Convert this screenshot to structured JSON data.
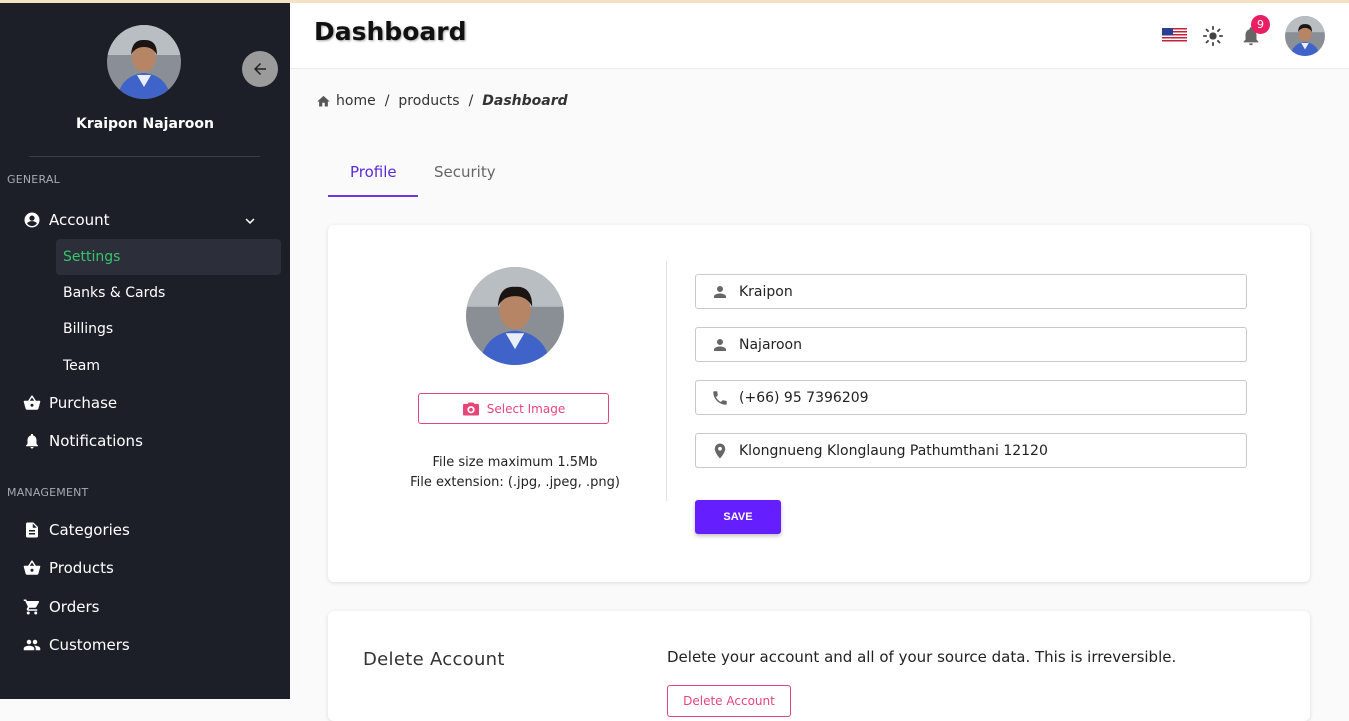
{
  "sidebar": {
    "user_name": "Kraipon Najaroon",
    "general_label": "GENERAL",
    "management_label": "MANAGEMENT",
    "account_label": "Account",
    "sub_items": [
      "Settings",
      "Banks & Cards",
      "Billings",
      "Team"
    ],
    "purchase_label": "Purchase",
    "notifications_label": "Notifications",
    "categories_label": "Categories",
    "products_label": "Products",
    "orders_label": "Orders",
    "customers_label": "Customers",
    "active_color": "#35c46a"
  },
  "header": {
    "title": "Dashboard",
    "notification_count": "9"
  },
  "breadcrumb": {
    "home": "home",
    "products": "products",
    "current": "Dashboard"
  },
  "tabs": {
    "profile": "Profile",
    "security": "Security"
  },
  "profile": {
    "select_image_label": "Select Image",
    "file_size_text": "File size maximum 1.5Mb",
    "file_ext_text": "File extension: (.jpg, .jpeg, .png)",
    "first_name": "Kraipon",
    "last_name": "Najaroon",
    "phone": "(+66) 95 7396209",
    "address": "Klongnueng Klonglaung Pathumthani 12120",
    "save_label": "SAVE"
  },
  "delete_account": {
    "title": "Delete Account",
    "description": "Delete your account and all of your source data. This is irreversible.",
    "button_label": "Delete Account"
  },
  "colors": {
    "accent": "#651fff",
    "danger": "#e6457a",
    "sidebar_bg": "#1c1f28"
  }
}
